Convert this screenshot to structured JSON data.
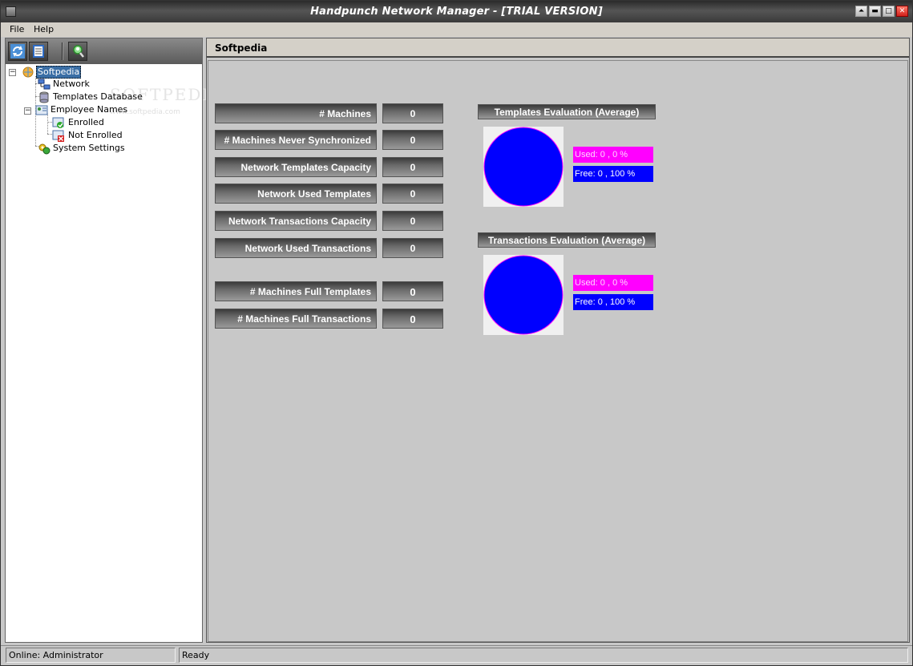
{
  "window": {
    "title": "Handpunch Network Manager - [TRIAL VERSION]",
    "min_glyph": "▬",
    "max_glyph": "□",
    "restore_glyph": "⏶",
    "close_glyph": "✕"
  },
  "menu": {
    "items": [
      {
        "label": "File"
      },
      {
        "label": "Help"
      }
    ]
  },
  "toolbar": {
    "buttons": [
      {
        "icon": "refresh-icon"
      },
      {
        "icon": "report-icon"
      },
      {
        "icon": "search-user-icon"
      }
    ]
  },
  "tree": {
    "root": {
      "label": "Softpedia",
      "icon": "globe-icon"
    },
    "items": [
      {
        "label": "Network",
        "icon": "network-icon"
      },
      {
        "label": "Templates Database",
        "icon": "database-icon"
      },
      {
        "label": "Employee Names",
        "icon": "employees-icon"
      },
      {
        "label": "Enrolled",
        "icon": "enrolled-icon"
      },
      {
        "label": "Not Enrolled",
        "icon": "not-enrolled-icon"
      },
      {
        "label": "System Settings",
        "icon": "settings-icon"
      }
    ],
    "watermark": "SOFTPEDIA",
    "watermark_url": "www.softpedia.com"
  },
  "panel": {
    "header": "Softpedia"
  },
  "stats": [
    {
      "label": "# Machines",
      "value": "0"
    },
    {
      "label": "# Machines Never Synchronized",
      "value": "0"
    },
    {
      "label": "Network Templates Capacity",
      "value": "0"
    },
    {
      "label": "Network Used Templates",
      "value": "0"
    },
    {
      "label": "Network Transactions Capacity",
      "value": "0"
    },
    {
      "label": "Network Used Transactions",
      "value": "0"
    },
    {
      "label": "# Machines Full Templates",
      "value": "0"
    },
    {
      "label": "# Machines Full Transactions",
      "value": "0"
    }
  ],
  "evaluations": [
    {
      "title": "Templates Evaluation (Average)",
      "used": "Used: 0 , 0 %",
      "free": "Free: 0 , 100 %"
    },
    {
      "title": "Transactions Evaluation (Average)",
      "used": "Used: 0 , 0 %",
      "free": "Free: 0 , 100 %"
    }
  ],
  "colors": {
    "used": "#ff00ff",
    "free": "#0000ff"
  },
  "status": {
    "user": "Online: Administrator",
    "state": "Ready"
  }
}
